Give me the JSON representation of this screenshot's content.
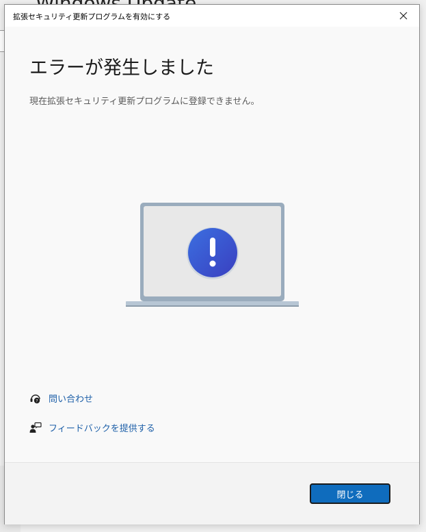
{
  "background": {
    "app_title": "Windows Update"
  },
  "dialog": {
    "window_title": "拡張セキュリティ更新プログラムを有効にする",
    "heading": "エラーが発生しました",
    "description": "現在拡張セキュリティ更新プログラムに登録できません。",
    "illustration_icon": "exclamation-icon",
    "links": [
      {
        "label": "問い合わせ",
        "icon": "contact-support-icon"
      },
      {
        "label": "フィードバックを提供する",
        "icon": "feedback-icon"
      }
    ],
    "close_button": "閉じる"
  },
  "colors": {
    "accent": "#0f6cbd",
    "link": "#1d5fa8",
    "alert_blue": "#2f55d4"
  }
}
